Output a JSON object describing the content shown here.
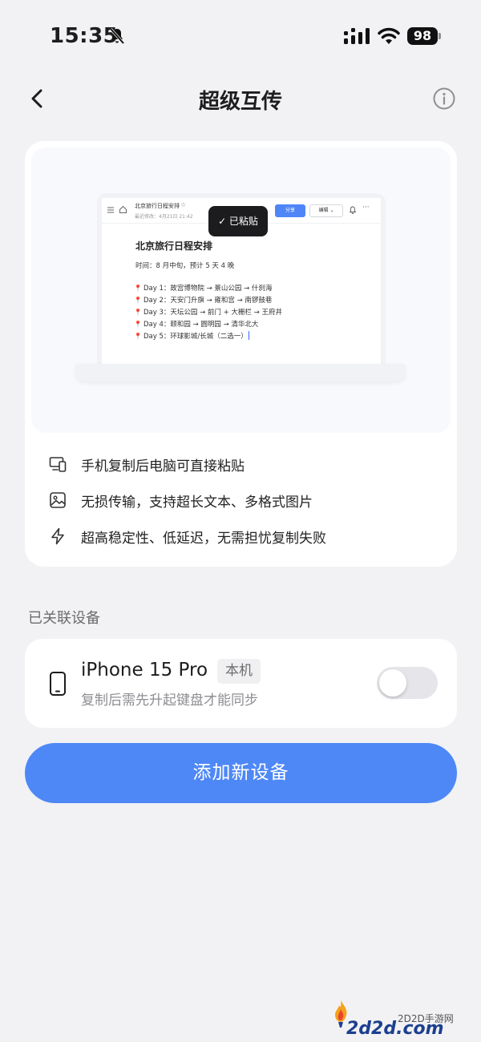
{
  "status_bar": {
    "time": "15:35",
    "battery": "98",
    "icons": [
      "bell-slash-icon",
      "signal-icon",
      "wifi-icon",
      "battery-icon"
    ]
  },
  "nav": {
    "title": "超级互传",
    "back_icon": "chevron-left-icon",
    "info_icon": "info-circle-icon"
  },
  "preview": {
    "doc_name": "北京旅行日程安排",
    "doc_edited": "最近修改：4月21日 21:42",
    "share_label": "分享",
    "edit_label": "编辑",
    "toast": "✓ 已粘贴",
    "doc_title": "北京旅行日程安排",
    "doc_subtitle": "时间：8 月中旬，预计 5 天 4 晚",
    "lines": [
      "Day 1：故宫博物院 → 景山公园 → 什刹海",
      "Day 2：天安门升旗 → 雍和宫 → 南锣鼓巷",
      "Day 3：天坛公园 → 前门 + 大栅栏 → 王府井",
      "Day 4：颐和园 → 圆明园 → 清华北大",
      "Day 5：环球影城/长城（二选一）"
    ]
  },
  "features": [
    {
      "icon": "devices-icon",
      "text": "手机复制后电脑可直接粘贴"
    },
    {
      "icon": "image-icon",
      "text": "无损传输，支持超长文本、多格式图片"
    },
    {
      "icon": "lightning-icon",
      "text": "超高稳定性、低延迟，无需担忧复制失败"
    }
  ],
  "linked_devices": {
    "label": "已关联设备",
    "device": {
      "icon": "phone-icon",
      "name": "iPhone 15 Pro",
      "badge": "本机",
      "hint": "复制后需先升起键盘才能同步",
      "sync_enabled": false
    }
  },
  "add_device_label": "添加新设备",
  "watermark": {
    "cn": "2D2D手游网",
    "url": "2d2d.com"
  },
  "colors": {
    "accent": "#4e88f6",
    "background": "#f2f2f4",
    "card": "#ffffff",
    "toast": "#1c1c1e"
  }
}
